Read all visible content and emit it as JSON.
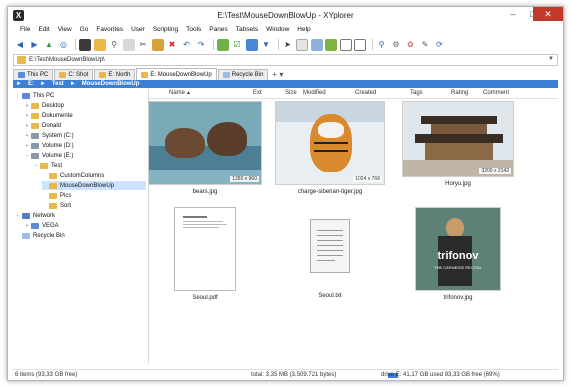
{
  "window": {
    "title": "E:\\Test\\MouseDownBlowUp - XYplorer",
    "controls": [
      "–",
      "□",
      "✕"
    ]
  },
  "menu": [
    "File",
    "Edit",
    "View",
    "Go",
    "Favorites",
    "User",
    "Scripting",
    "Tools",
    "Panes",
    "Tabsets",
    "Window",
    "Help"
  ],
  "toolbar": {
    "icons": [
      "back-arrow",
      "forward-arrow",
      "up-arrow",
      "target",
      "monitor",
      "paste",
      "search",
      "copy",
      "cut",
      "paste-special",
      "delete",
      "undo",
      "redo",
      "move-to",
      "checkbox",
      "preview",
      "filter",
      "send",
      "document",
      "tag",
      "android",
      "layout-1",
      "layout-2",
      "zoom",
      "settings",
      "colors",
      "brush",
      "refresh"
    ]
  },
  "address": {
    "value": "E:\\Test\\MouseDownBlowUp\\"
  },
  "tabs": [
    {
      "label": "This PC",
      "kind": "pc"
    },
    {
      "label": "C: Shot",
      "kind": "folder"
    },
    {
      "label": "E: North",
      "kind": "folder"
    },
    {
      "label": "E: MouseDownBlowUp",
      "kind": "folder",
      "active": true
    },
    {
      "label": "Recycle Bin",
      "kind": "bin"
    }
  ],
  "breadcrumb": [
    "►",
    "E:",
    "►",
    "Test",
    "►",
    "MouseDownBlowUp"
  ],
  "tree": [
    {
      "label": "This PC",
      "indent": 0,
      "icon": "pc",
      "exp": ""
    },
    {
      "label": "Desktop",
      "indent": 1,
      "icon": "fi",
      "exp": "+"
    },
    {
      "label": "Dokumente",
      "indent": 1,
      "icon": "fi",
      "exp": "+"
    },
    {
      "label": "Donald",
      "indent": 1,
      "icon": "fi",
      "exp": "+"
    },
    {
      "label": "System (C:)",
      "indent": 1,
      "icon": "drv",
      "exp": "+"
    },
    {
      "label": "Volume (D:)",
      "indent": 1,
      "icon": "drv",
      "exp": "+"
    },
    {
      "label": "Volume (E:)",
      "indent": 1,
      "icon": "drv",
      "exp": "−"
    },
    {
      "label": "Test",
      "indent": 2,
      "icon": "fi",
      "exp": "−"
    },
    {
      "label": "CustomColumns",
      "indent": 3,
      "icon": "fi",
      "exp": ""
    },
    {
      "label": "MouseDownBlowUp",
      "indent": 3,
      "icon": "fi",
      "exp": "",
      "selected": true
    },
    {
      "label": "Pics",
      "indent": 3,
      "icon": "fi",
      "exp": ""
    },
    {
      "label": "Sort",
      "indent": 3,
      "icon": "fi",
      "exp": ""
    },
    {
      "label": "Network",
      "indent": 0,
      "icon": "net",
      "exp": "−"
    },
    {
      "label": "VEGA",
      "indent": 1,
      "icon": "pc",
      "exp": "+"
    },
    {
      "label": "Recycle Bin",
      "indent": 0,
      "icon": "bin",
      "exp": ""
    }
  ],
  "columns": [
    "Name",
    "▲",
    "Ext",
    "Size",
    "Modified",
    "Created",
    "Tags",
    "Rating",
    "Comment"
  ],
  "files": [
    {
      "name": "bears.jpg",
      "dims": "1280 x 960",
      "kind": "bears"
    },
    {
      "name": "charge-siberian-tiger.jpg",
      "dims": "1024 x 768",
      "kind": "tiger"
    },
    {
      "name": "Horyu.jpg",
      "dims": "3200 x 2142",
      "kind": "temple"
    },
    {
      "name": "Seoul.pdf",
      "dims": "",
      "kind": "pdf"
    },
    {
      "name": "Seoul.txt",
      "dims": "",
      "kind": "txt"
    },
    {
      "name": "trifonov.jpg",
      "dims": "",
      "kind": "album",
      "album_artist": "trifonov",
      "album_subtitle": "THE CARNEGIE RECITAL"
    }
  ],
  "status": {
    "items": "6 items (93,33 GB free)",
    "total": "total: 3,35 MB (3.509.721 bytes)",
    "drive": "drive E:  41,17 GB used   93,33 GB free (69%)"
  }
}
